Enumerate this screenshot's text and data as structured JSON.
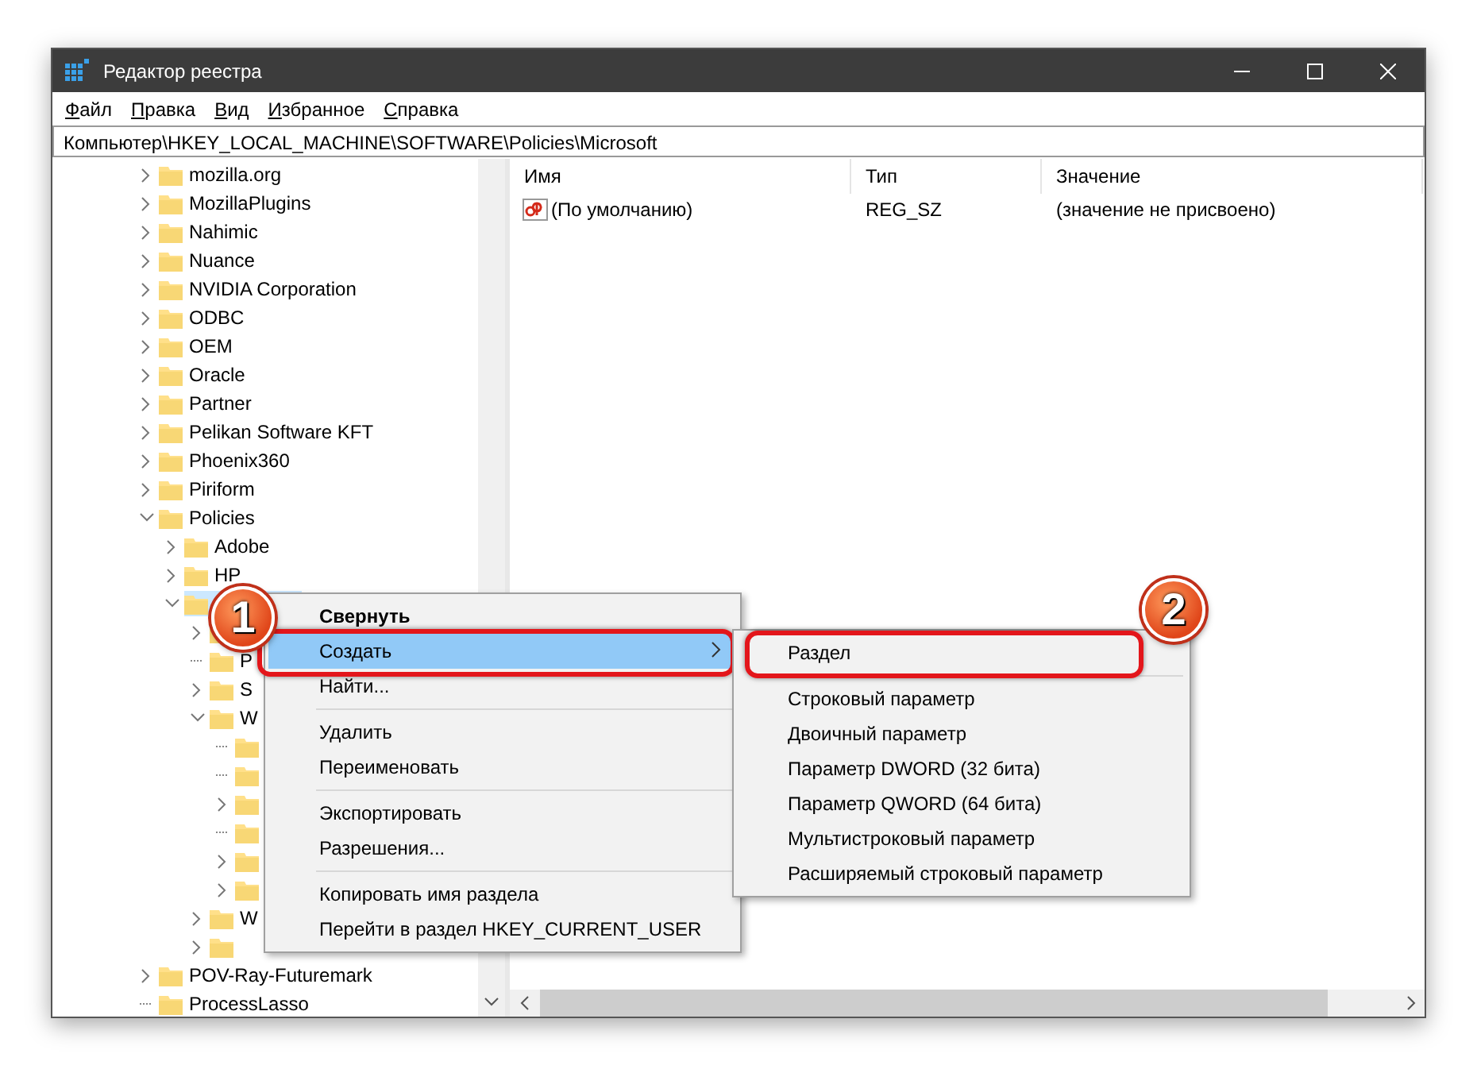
{
  "window": {
    "title": "Редактор реестра"
  },
  "menu_bar": [
    "Файл",
    "Правка",
    "Вид",
    "Избранное",
    "Справка"
  ],
  "address": "Компьютер\\HKEY_LOCAL_MACHINE\\SOFTWARE\\Policies\\Microsoft",
  "tree": [
    {
      "label": "mozilla.org",
      "kind": "branch",
      "expanded": false,
      "selected": false
    },
    {
      "label": "MozillaPlugins",
      "kind": "branch",
      "expanded": false,
      "selected": false
    },
    {
      "label": "Nahimic",
      "kind": "branch",
      "expanded": false,
      "selected": false
    },
    {
      "label": "Nuance",
      "kind": "branch",
      "expanded": false,
      "selected": false
    },
    {
      "label": "NVIDIA Corporation",
      "kind": "branch",
      "expanded": false,
      "selected": false
    },
    {
      "label": "ODBC",
      "kind": "branch",
      "expanded": false,
      "selected": false
    },
    {
      "label": "OEM",
      "kind": "branch",
      "expanded": false,
      "selected": false
    },
    {
      "label": "Oracle",
      "kind": "branch",
      "expanded": false,
      "selected": false
    },
    {
      "label": "Partner",
      "kind": "branch",
      "expanded": false,
      "selected": false
    },
    {
      "label": "Pelikan Software KFT",
      "kind": "branch",
      "expanded": false,
      "selected": false
    },
    {
      "label": "Phoenix360",
      "kind": "branch",
      "expanded": false,
      "selected": false
    },
    {
      "label": "Piriform",
      "kind": "branch",
      "expanded": false,
      "selected": false
    },
    {
      "label": "Policies",
      "kind": "branch",
      "expanded": true,
      "selected": false,
      "children": [
        {
          "label": "Adobe",
          "kind": "branch",
          "expanded": false,
          "selected": false
        },
        {
          "label": "HP",
          "kind": "branch",
          "expanded": false,
          "selected": false
        },
        {
          "kind": "branch",
          "expanded": true,
          "selected": true,
          "children": [
            {
              "kind": "branch",
              "expanded": false,
              "selected": false
            },
            {
              "label": "P",
              "kind": "leaf",
              "selected": false
            },
            {
              "label": "S",
              "kind": "branch",
              "expanded": false,
              "selected": false
            },
            {
              "label": "W",
              "kind": "branch",
              "expanded": true,
              "selected": false,
              "children": [
                {
                  "kind": "leaf",
                  "selected": false
                },
                {
                  "kind": "leaf",
                  "selected": false
                },
                {
                  "kind": "branch",
                  "expanded": false,
                  "selected": false
                },
                {
                  "kind": "leaf",
                  "selected": false
                },
                {
                  "kind": "branch",
                  "expanded": false,
                  "selected": false
                },
                {
                  "kind": "branch",
                  "expanded": false,
                  "selected": false
                }
              ]
            },
            {
              "label": "W",
              "kind": "branch",
              "expanded": false,
              "selected": false
            },
            {
              "kind": "branch",
              "expanded": false,
              "selected": false
            }
          ]
        }
      ]
    },
    {
      "label": "POV-Ray-Futuremark",
      "kind": "branch",
      "expanded": false,
      "selected": false
    },
    {
      "label": "ProcessLasso",
      "kind": "leaf",
      "selected": false
    }
  ],
  "list": {
    "columns": [
      "Имя",
      "Тип",
      "Значение"
    ],
    "rows": [
      {
        "name": "(По умолчанию)",
        "type": "REG_SZ",
        "value": "(значение не присвоено)"
      }
    ]
  },
  "context_menu": [
    {
      "kind": "item",
      "label": "Свернуть",
      "bold": true,
      "selected": false,
      "submenu": false
    },
    {
      "kind": "item",
      "label": "Создать",
      "bold": false,
      "selected": true,
      "submenu": true,
      "callout": "1"
    },
    {
      "kind": "item",
      "label": "Найти...",
      "bold": false,
      "selected": false,
      "submenu": false
    },
    {
      "kind": "separator"
    },
    {
      "kind": "item",
      "label": "Удалить",
      "bold": false,
      "selected": false,
      "submenu": false
    },
    {
      "kind": "item",
      "label": "Переименовать",
      "bold": false,
      "selected": false,
      "submenu": false
    },
    {
      "kind": "separator"
    },
    {
      "kind": "item",
      "label": "Экспортировать",
      "bold": false,
      "selected": false,
      "submenu": false
    },
    {
      "kind": "item",
      "label": "Разрешения...",
      "bold": false,
      "selected": false,
      "submenu": false
    },
    {
      "kind": "separator"
    },
    {
      "kind": "item",
      "label": "Копировать имя раздела",
      "bold": false,
      "selected": false,
      "submenu": false
    },
    {
      "kind": "item",
      "label": "Перейти в раздел HKEY_CURRENT_USER",
      "bold": false,
      "selected": false,
      "submenu": false
    }
  ],
  "submenu": [
    {
      "kind": "item",
      "label": "Раздел",
      "callout": "2"
    },
    {
      "kind": "separator"
    },
    {
      "kind": "item",
      "label": "Строковый параметр"
    },
    {
      "kind": "item",
      "label": "Двоичный параметр"
    },
    {
      "kind": "item",
      "label": "Параметр DWORD (32 бита)"
    },
    {
      "kind": "item",
      "label": "Параметр QWORD (64 бита)"
    },
    {
      "kind": "item",
      "label": "Мультистроковый параметр"
    },
    {
      "kind": "item",
      "label": "Расширяемый строковый параметр"
    }
  ]
}
